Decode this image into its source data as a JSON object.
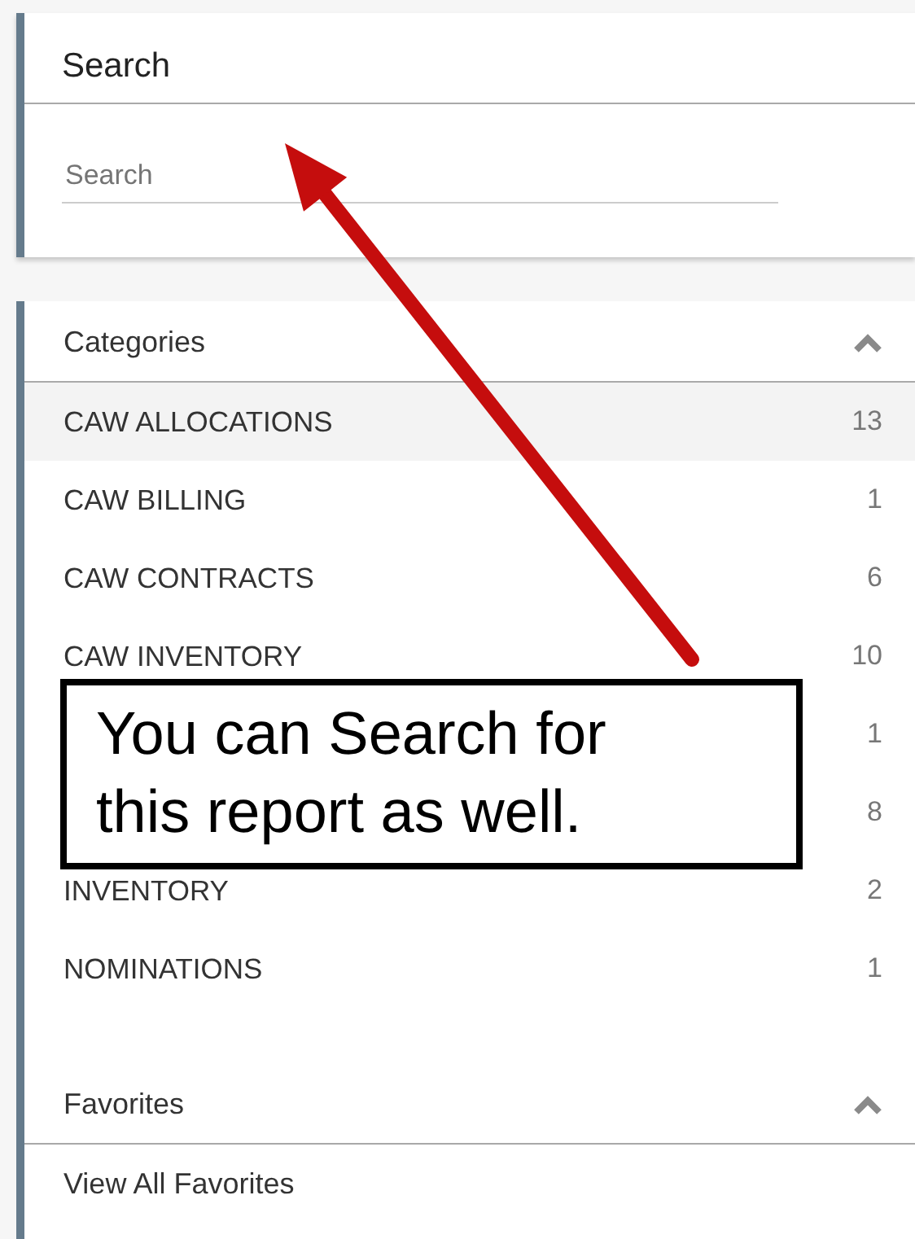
{
  "search_panel": {
    "title": "Search",
    "placeholder": "Search"
  },
  "categories": {
    "title": "Categories",
    "expanded": true,
    "items": [
      {
        "name": "CAW ALLOCATIONS",
        "count": "13",
        "selected": true
      },
      {
        "name": "CAW BILLING",
        "count": "1",
        "selected": false
      },
      {
        "name": "CAW CONTRACTS",
        "count": "6",
        "selected": false
      },
      {
        "name": "CAW INVENTORY",
        "count": "10",
        "selected": false
      },
      {
        "count": "1",
        "selected": false
      },
      {
        "count": "8",
        "selected": false
      },
      {
        "name": "INVENTORY",
        "count": "2",
        "selected": false
      },
      {
        "name": "NOMINATIONS",
        "count": "1",
        "selected": false
      }
    ]
  },
  "favorites": {
    "title": "Favorites",
    "expanded": true,
    "items": [
      "View All Favorites"
    ]
  },
  "annotation": {
    "text": "You can Search for this report as well."
  }
}
